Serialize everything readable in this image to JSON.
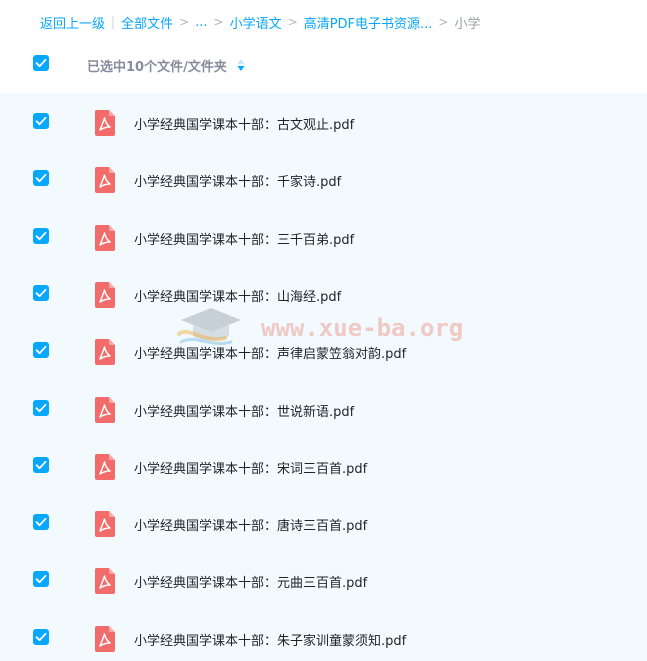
{
  "breadcrumb": {
    "back": "返回上一级",
    "all_files": "全部文件",
    "ellipsis": "...",
    "folder_1": "小学语文",
    "folder_2": "高清PDF电子书资源...",
    "current": "小学"
  },
  "header": {
    "selected_text": "已选中10个文件/文件夹"
  },
  "files": [
    {
      "name": "小学经典国学课本十部：古文观止.pdf",
      "checked": true
    },
    {
      "name": "小学经典国学课本十部：千家诗.pdf",
      "checked": true
    },
    {
      "name": "小学经典国学课本十部：三千百弟.pdf",
      "checked": true
    },
    {
      "name": "小学经典国学课本十部：山海经.pdf",
      "checked": true
    },
    {
      "name": "小学经典国学课本十部：声律启蒙笠翁对韵.pdf",
      "checked": true
    },
    {
      "name": "小学经典国学课本十部：世说新语.pdf",
      "checked": true
    },
    {
      "name": "小学经典国学课本十部：宋词三百首.pdf",
      "checked": true
    },
    {
      "name": "小学经典国学课本十部：唐诗三百首.pdf",
      "checked": true
    },
    {
      "name": "小学经典国学课本十部：元曲三百首.pdf",
      "checked": true
    },
    {
      "name": "小学经典国学课本十部：朱子家训童蒙须知.pdf",
      "checked": true
    }
  ],
  "watermark": {
    "text": "www.xue-ba.org"
  },
  "colors": {
    "accent": "#06a7ff",
    "list_background": "#f2fafe",
    "pdf_icon": "#f26c6c"
  },
  "icons": {
    "checkbox": "checkbox-checked-icon",
    "file": "pdf-file-icon",
    "sort": "sort-icon"
  }
}
